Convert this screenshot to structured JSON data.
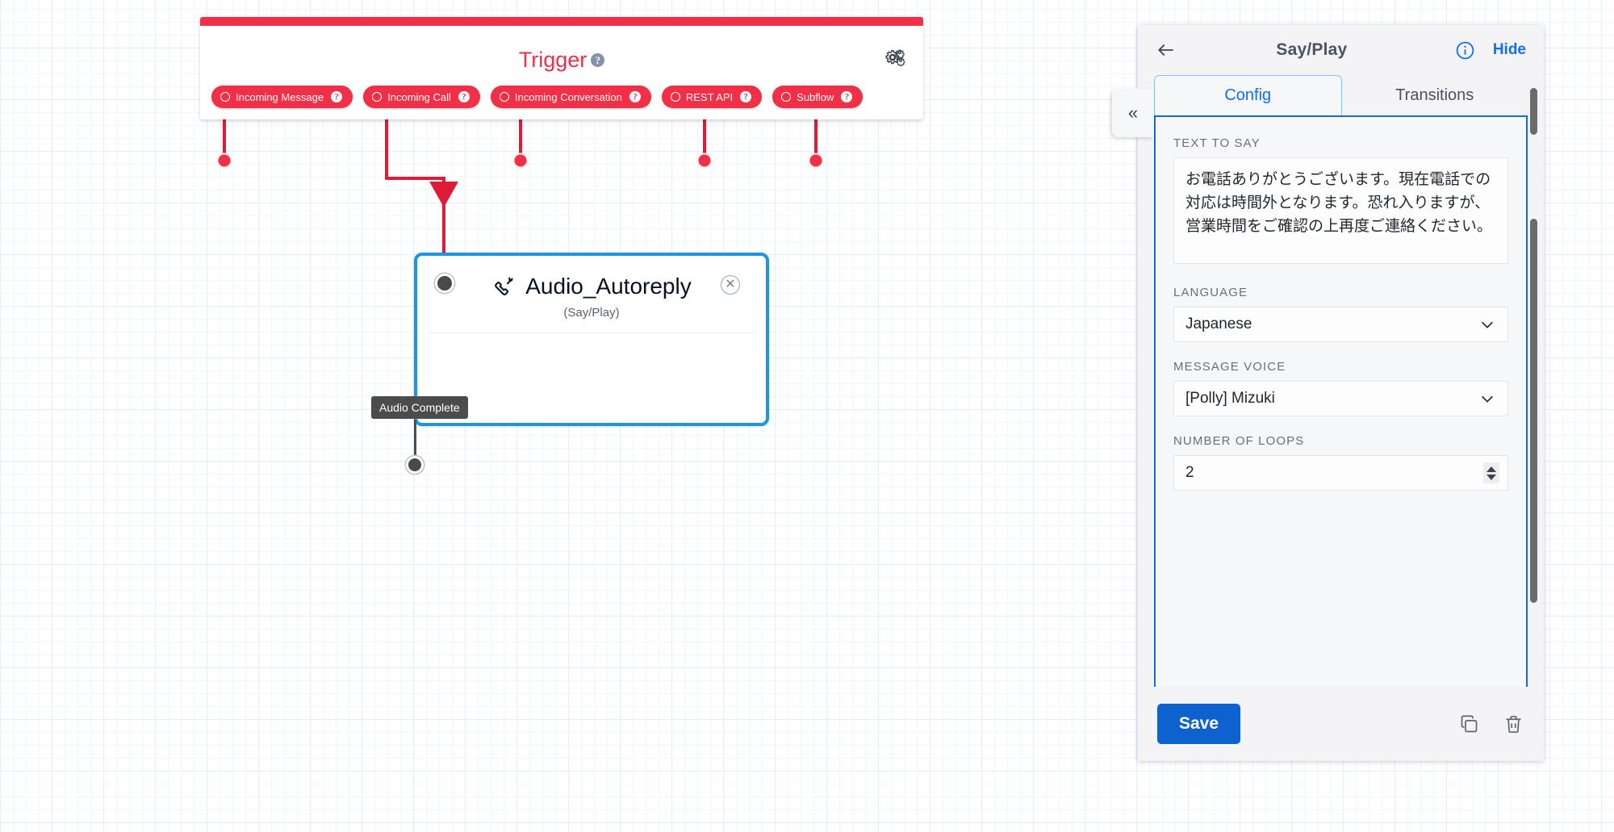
{
  "canvas": {
    "trigger": {
      "title": "Trigger",
      "help_glyph": "?",
      "gear_icon": "gears-icon",
      "pills": [
        {
          "label": "Incoming Message",
          "help": "?"
        },
        {
          "label": "Incoming Call",
          "help": "?"
        },
        {
          "label": "Incoming Conversation",
          "help": "?"
        },
        {
          "label": "REST API",
          "help": "?"
        },
        {
          "label": "Subflow",
          "help": "?"
        }
      ],
      "accent_color": "#f22f46"
    },
    "flow_node": {
      "title": "Audio_Autoreply",
      "subtitle": "(Say/Play)",
      "icon": "phone-call-icon",
      "close_glyph": "✕",
      "transition_label": "Audio Complete",
      "border_color": "#1f94e0"
    }
  },
  "panel": {
    "header": {
      "back_icon": "back-arrow-icon",
      "title": "Say/Play",
      "info_icon": "info-circle-icon",
      "hide_label": "Hide"
    },
    "tabs": [
      {
        "label": "Config",
        "active": true
      },
      {
        "label": "Transitions",
        "active": false
      }
    ],
    "fields": {
      "text_to_say": {
        "label": "TEXT TO SAY",
        "value": "お電話ありがとうございます。現在電話での対応は時間外となります。恐れ入りますが、営業時間をご確認の上再度ご連絡ください。"
      },
      "language": {
        "label": "LANGUAGE",
        "value": "Japanese"
      },
      "message_voice": {
        "label": "MESSAGE VOICE",
        "value": "[Polly] Mizuki"
      },
      "number_of_loops": {
        "label": "NUMBER OF LOOPS",
        "value": "2"
      }
    },
    "footer": {
      "save_label": "Save",
      "copy_icon": "copy-icon",
      "delete_icon": "trash-icon"
    },
    "collapse_handle": "«",
    "accent_color": "#0d6efd"
  }
}
